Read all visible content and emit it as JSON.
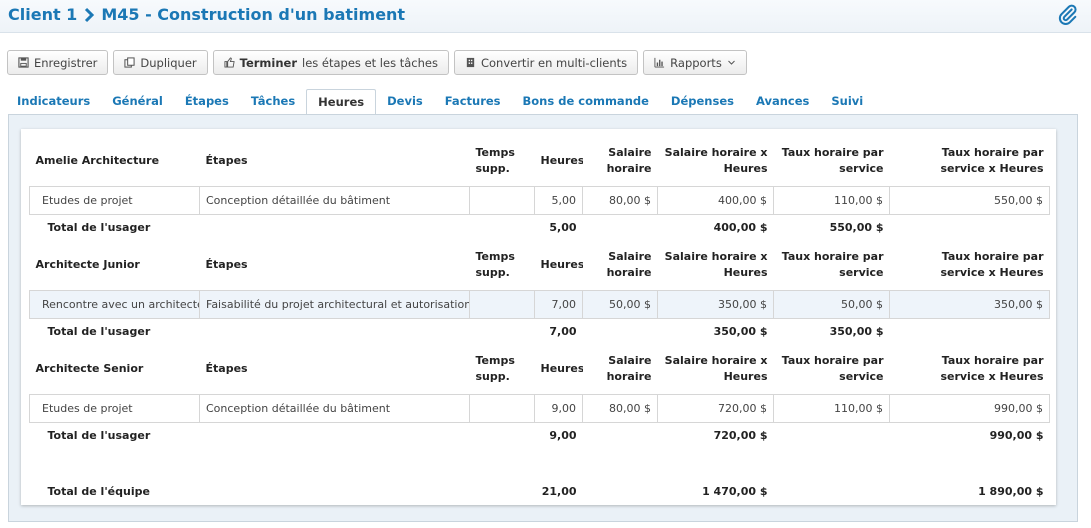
{
  "header": {
    "client": "Client 1",
    "project": "M45 - Construction d'un batiment"
  },
  "toolbar": {
    "save": "Enregistrer",
    "duplicate": "Dupliquer",
    "finish_bold": "Terminer",
    "finish_rest": "les étapes et les tâches",
    "convert": "Convertir en multi-clients",
    "reports": "Rapports"
  },
  "tabs": [
    "Indicateurs",
    "Général",
    "Étapes",
    "Tâches",
    "Heures",
    "Devis",
    "Factures",
    "Bons de commande",
    "Dépenses",
    "Avances",
    "Suivi"
  ],
  "active_tab": "Heures",
  "columns": {
    "etapes": "Étapes",
    "temps": "Temps supp.",
    "heures": "Heures",
    "salaire": "Salaire horaire",
    "salaire_x": "Salaire horaire x Heures",
    "taux": "Taux horaire par service",
    "taux_x": "Taux horaire par service x Heures"
  },
  "groups": [
    {
      "user": "Amelie Architecture",
      "rows": [
        {
          "task": "Etudes de projet",
          "step": "Conception détaillée du bâtiment",
          "extra": "",
          "hours": "5,00",
          "rate": "80,00 $",
          "rate_x": "400,00 $",
          "service": "110,00 $",
          "service_x": "550,00 $"
        }
      ],
      "total": {
        "label": "Total de l'usager",
        "hours": "5,00",
        "rate_x": "400,00 $",
        "service": "550,00 $",
        "service_x": ""
      }
    },
    {
      "user": "Architecte Junior",
      "rows": [
        {
          "task": "Rencontre avec un architecte",
          "step": "Faisabilité du projet architectural et autorisation",
          "extra": "",
          "hours": "7,00",
          "rate": "50,00 $",
          "rate_x": "350,00 $",
          "service": "50,00 $",
          "service_x": "350,00 $"
        }
      ],
      "total": {
        "label": "Total de l'usager",
        "hours": "7,00",
        "rate_x": "350,00 $",
        "service": "350,00 $",
        "service_x": ""
      }
    },
    {
      "user": "Architecte Senior",
      "rows": [
        {
          "task": "Etudes de projet",
          "step": "Conception détaillée du bâtiment",
          "extra": "",
          "hours": "9,00",
          "rate": "80,00 $",
          "rate_x": "720,00 $",
          "service": "110,00 $",
          "service_x": "990,00 $"
        }
      ],
      "total": {
        "label": "Total de l'usager",
        "hours": "9,00",
        "rate_x": "720,00 $",
        "service": "",
        "service_x": "990,00 $"
      }
    }
  ],
  "team_total": {
    "label": "Total de l'équipe",
    "hours": "21,00",
    "rate_x": "1 470,00 $",
    "service_x": "1 890,00 $"
  },
  "colors": {
    "accent": "#1b78b5",
    "highlight_row": "#eef4fa"
  }
}
